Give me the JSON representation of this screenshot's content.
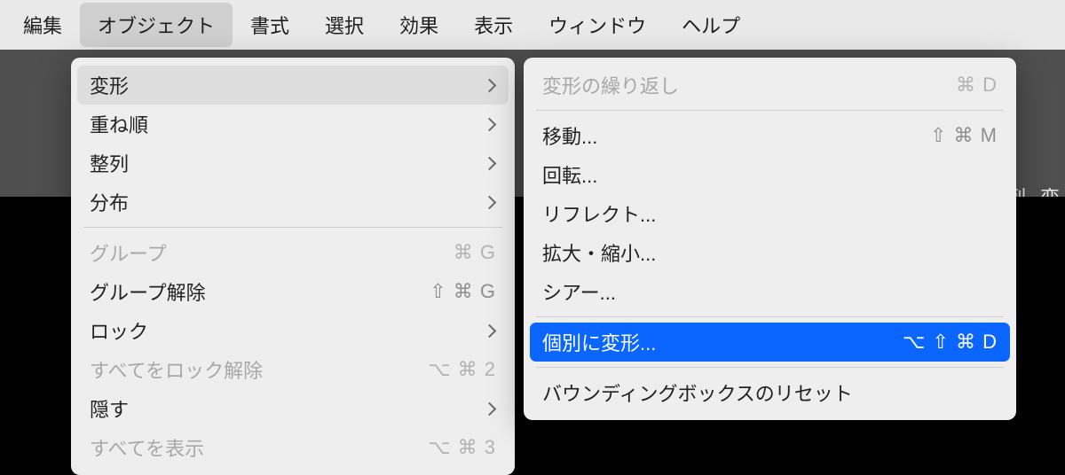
{
  "menubar": {
    "items": [
      "編集",
      "オブジェクト",
      "書式",
      "選択",
      "効果",
      "表示",
      "ウィンドウ",
      "ヘルプ"
    ],
    "active_index": 1
  },
  "toolbar_partial": [
    "列",
    "変"
  ],
  "menu_object": {
    "groups": [
      [
        {
          "label": "変形",
          "submenu": true,
          "highlight": true
        },
        {
          "label": "重ね順",
          "submenu": true
        },
        {
          "label": "整列",
          "submenu": true
        },
        {
          "label": "分布",
          "submenu": true
        }
      ],
      [
        {
          "label": "グループ",
          "shortcut": "⌘ G",
          "disabled": true
        },
        {
          "label": "グループ解除",
          "shortcut": "⇧ ⌘ G"
        },
        {
          "label": "ロック",
          "submenu": true
        },
        {
          "label": "すべてをロック解除",
          "shortcut": "⌥ ⌘ 2",
          "disabled": true
        },
        {
          "label": "隠す",
          "submenu": true
        },
        {
          "label": "すべてを表示",
          "shortcut": "⌥ ⌘ 3",
          "disabled": true
        }
      ]
    ]
  },
  "menu_transform": {
    "groups": [
      [
        {
          "label": "変形の繰り返し",
          "shortcut": "⌘ D",
          "disabled": true
        }
      ],
      [
        {
          "label": "移動...",
          "shortcut": "⇧ ⌘ M"
        },
        {
          "label": "回転..."
        },
        {
          "label": "リフレクト..."
        },
        {
          "label": "拡大・縮小..."
        },
        {
          "label": "シアー..."
        }
      ],
      [
        {
          "label": "個別に変形...",
          "shortcut": "⌥ ⇧ ⌘ D",
          "selected": true
        }
      ],
      [
        {
          "label": "バウンディングボックスのリセット"
        }
      ]
    ]
  }
}
